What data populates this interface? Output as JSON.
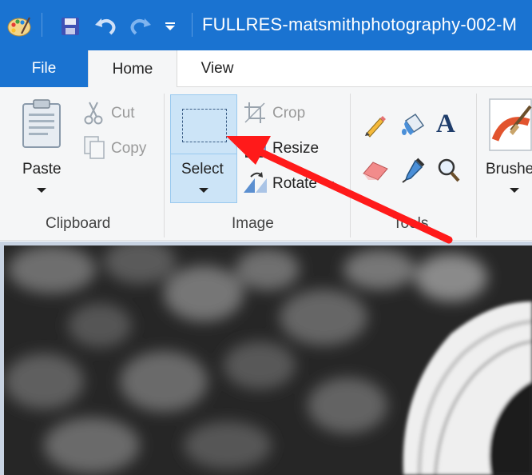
{
  "window": {
    "title": "FULLRES-matsmithphotography-002-M"
  },
  "quick_access": {
    "app_icon": "paint-app-icon",
    "save_icon": "save-icon",
    "undo_icon": "undo-icon",
    "redo_icon": "redo-icon",
    "customize_icon": "customize-dropdown-icon"
  },
  "tabs": {
    "file": "File",
    "home": "Home",
    "view": "View"
  },
  "clipboard": {
    "paste": "Paste",
    "cut": "Cut",
    "copy": "Copy",
    "label": "Clipboard"
  },
  "image": {
    "select": "Select",
    "crop": "Crop",
    "resize": "Resize",
    "rotate": "Rotate",
    "label": "Image"
  },
  "tools": {
    "label": "Tools",
    "pencil": "pencil-icon",
    "fill": "fill-bucket-icon",
    "text": "A",
    "eraser": "eraser-icon",
    "picker": "color-picker-icon",
    "magnifier": "magnifier-icon"
  },
  "brushes": {
    "label": "Brushes"
  },
  "colors": {
    "accent": "#1a73d1",
    "ribbon_bg": "#f5f6f7",
    "select_highlight": "#cce4f7",
    "annotation_arrow": "#ff1a1a"
  }
}
